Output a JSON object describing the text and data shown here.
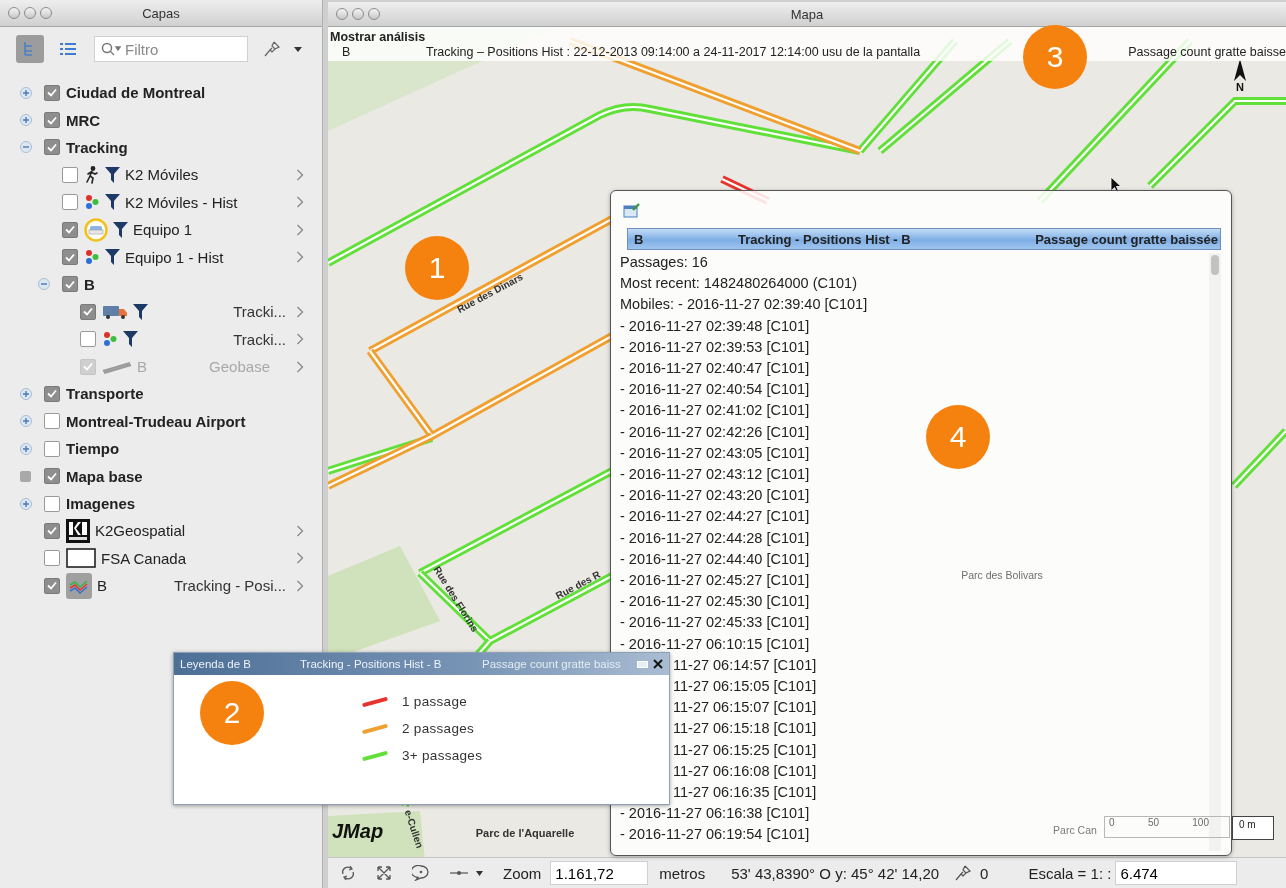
{
  "layers_window": {
    "title": "Capas",
    "view_modes": [
      {
        "kind": "tree",
        "selected": true
      },
      {
        "kind": "list",
        "selected": false
      }
    ],
    "search": {
      "placeholder": "Filtro"
    }
  },
  "layers": [
    {
      "kind": "group",
      "label": "Ciudad de Montreal",
      "checked": true,
      "expanded": false
    },
    {
      "kind": "group",
      "label": "MRC",
      "checked": true,
      "expanded": false
    },
    {
      "kind": "group",
      "label": "Tracking",
      "checked": true,
      "expanded": true,
      "children": [
        {
          "kind": "mobile-layer",
          "label": "K2 Móviles",
          "checked": false,
          "filtered": true
        },
        {
          "kind": "history-layer",
          "label": "K2 Móviles - Hist",
          "checked": false,
          "filtered": true
        },
        {
          "kind": "vehicle-layer",
          "label": "Equipo 1",
          "checked": true,
          "filtered": true
        },
        {
          "kind": "history-layer",
          "label": "Equipo 1 - Hist",
          "checked": true,
          "filtered": true
        },
        {
          "kind": "group",
          "label": "B",
          "checked": true,
          "expanded": true,
          "children": [
            {
              "kind": "truck-layer",
              "detail": "Tracki...",
              "checked": true,
              "filtered": true,
              "disabled": false
            },
            {
              "kind": "history-layer",
              "detail": "Tracki...",
              "checked": false,
              "filtered": true,
              "disabled": false
            },
            {
              "kind": "geobase-layer",
              "label": "B",
              "detail": "Geobase",
              "checked": true,
              "filtered": false,
              "disabled": true
            }
          ]
        }
      ]
    },
    {
      "kind": "group",
      "label": "Transporte",
      "checked": true,
      "expanded": false
    },
    {
      "kind": "group",
      "label": "Montreal-Trudeau Airport",
      "checked": false,
      "expanded": false
    },
    {
      "kind": "group",
      "label": "Tiempo",
      "checked": false,
      "expanded": false
    },
    {
      "kind": "base-group",
      "label": "Mapa base",
      "checked": true
    },
    {
      "kind": "group",
      "label": "Imagenes",
      "checked": false,
      "expanded": false
    },
    {
      "kind": "logo-layer",
      "label": "K2Geospatial",
      "checked": true,
      "filtered": false
    },
    {
      "kind": "frame-layer",
      "label": "FSA Canada",
      "checked": false,
      "filtered": false
    },
    {
      "kind": "analysis-layer",
      "label": "B",
      "detail": "Tracking - Posi...",
      "checked": true,
      "filtered": false
    }
  ],
  "map_window": {
    "title": "Mapa",
    "analysis": {
      "title": "Mostrar análisis",
      "layer": "B",
      "description": "Tracking – Positions Hist : 22-12-2013 09:14:00 a 24-11-2017 12:14:00 usu de la pantalla",
      "metric": "Passage count gratte baisse"
    }
  },
  "map": {
    "streets": [
      "Rue des Dinars",
      "Rue des Florins",
      "Rue des R",
      "e-Cullen"
    ],
    "parks": [
      "Parc des Bolivars",
      "Parc de l'Aquarelle",
      "Parc Can"
    ],
    "logo": "JMap",
    "north": "N",
    "scale_ticks": [
      "0",
      "50",
      "100"
    ],
    "scale_end": "0 m"
  },
  "popup": {
    "layer": "B",
    "title": "Tracking - Positions Hist - B",
    "metric": "Passage count gratte baissée",
    "lines": [
      {
        "kind": "full",
        "text": "Passages: 16"
      },
      {
        "kind": "full",
        "text": "Most recent: 1482480264000 (C101)"
      },
      {
        "kind": "full",
        "text": "Mobiles: - 2016-11-27 02:39:40 [C101]"
      },
      {
        "kind": "full",
        "text": "- 2016-11-27 02:39:48 [C101]"
      },
      {
        "kind": "full",
        "text": "- 2016-11-27 02:39:53 [C101]"
      },
      {
        "kind": "full",
        "text": "- 2016-11-27 02:40:47 [C101]"
      },
      {
        "kind": "full",
        "text": "- 2016-11-27 02:40:54 [C101]"
      },
      {
        "kind": "full",
        "text": "- 2016-11-27 02:41:02 [C101]"
      },
      {
        "kind": "full",
        "text": "- 2016-11-27 02:42:26 [C101]"
      },
      {
        "kind": "full",
        "text": "- 2016-11-27 02:43:05 [C101]"
      },
      {
        "kind": "full",
        "text": "- 2016-11-27 02:43:12 [C101]"
      },
      {
        "kind": "full",
        "text": "- 2016-11-27 02:43:20 [C101]"
      },
      {
        "kind": "full",
        "text": "- 2016-11-27 02:44:27 [C101]"
      },
      {
        "kind": "full",
        "text": "- 2016-11-27 02:44:28 [C101]"
      },
      {
        "kind": "full",
        "text": "- 2016-11-27 02:44:40 [C101]"
      },
      {
        "kind": "full",
        "text": "- 2016-11-27 02:45:27 [C101]"
      },
      {
        "kind": "full",
        "text": "- 2016-11-27 02:45:30 [C101]"
      },
      {
        "kind": "full",
        "text": "- 2016-11-27 02:45:33 [C101]"
      },
      {
        "kind": "full",
        "text": "- 2016-11-27 06:10:15 [C101]"
      },
      {
        "kind": "partial",
        "text": "11-27 06:14:57 [C101]"
      },
      {
        "kind": "partial",
        "text": "11-27 06:15:05 [C101]"
      },
      {
        "kind": "partial",
        "text": "11-27 06:15:07 [C101]"
      },
      {
        "kind": "partial",
        "text": "11-27 06:15:18 [C101]"
      },
      {
        "kind": "partial",
        "text": "11-27 06:15:25 [C101]"
      },
      {
        "kind": "partial",
        "text": "11-27 06:16:08 [C101]"
      },
      {
        "kind": "partial",
        "text": "11-27 06:16:35 [C101]"
      },
      {
        "kind": "full",
        "text": "- 2016-11-27 06:16:38 [C101]"
      },
      {
        "kind": "full",
        "text": "- 2016-11-27 06:19:54 [C101]"
      }
    ]
  },
  "legend": {
    "title": "Leyenda de B",
    "layer": "Tracking - Positions Hist - B",
    "metric": "Passage count gratte baiss",
    "items": [
      {
        "label": "1 passage",
        "color": "#e8322c"
      },
      {
        "label": "2 passages",
        "color": "#f0a030"
      },
      {
        "label": "3+ passages",
        "color": "#62e03a"
      }
    ]
  },
  "callouts": [
    "1",
    "2",
    "3",
    "4"
  ],
  "status_bar": {
    "zoom_label": "Zoom",
    "zoom": "1.161,72",
    "unit": "metros",
    "coordinates": "53' 43,8390° O  y: 45° 42' 14,20",
    "selected_count": "0",
    "scale_label": "Escala = 1: :",
    "scale": "6.474"
  }
}
